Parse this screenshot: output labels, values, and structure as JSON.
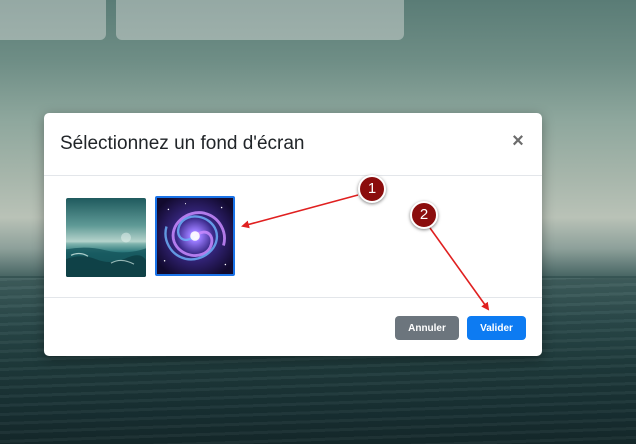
{
  "dialog": {
    "title": "Sélectionnez un fond d'écran",
    "close_label": "×",
    "wallpapers": [
      {
        "name": "ocean",
        "selected": false
      },
      {
        "name": "galaxy",
        "selected": true
      }
    ],
    "buttons": {
      "cancel_label": "Annuler",
      "confirm_label": "Valider"
    }
  },
  "annotations": [
    {
      "number": "1"
    },
    {
      "number": "2"
    }
  ],
  "colors": {
    "accent": "#0d7bf2",
    "cancel": "#6c757d",
    "annotation": "#8b0d0d",
    "arrow": "#e02020"
  }
}
